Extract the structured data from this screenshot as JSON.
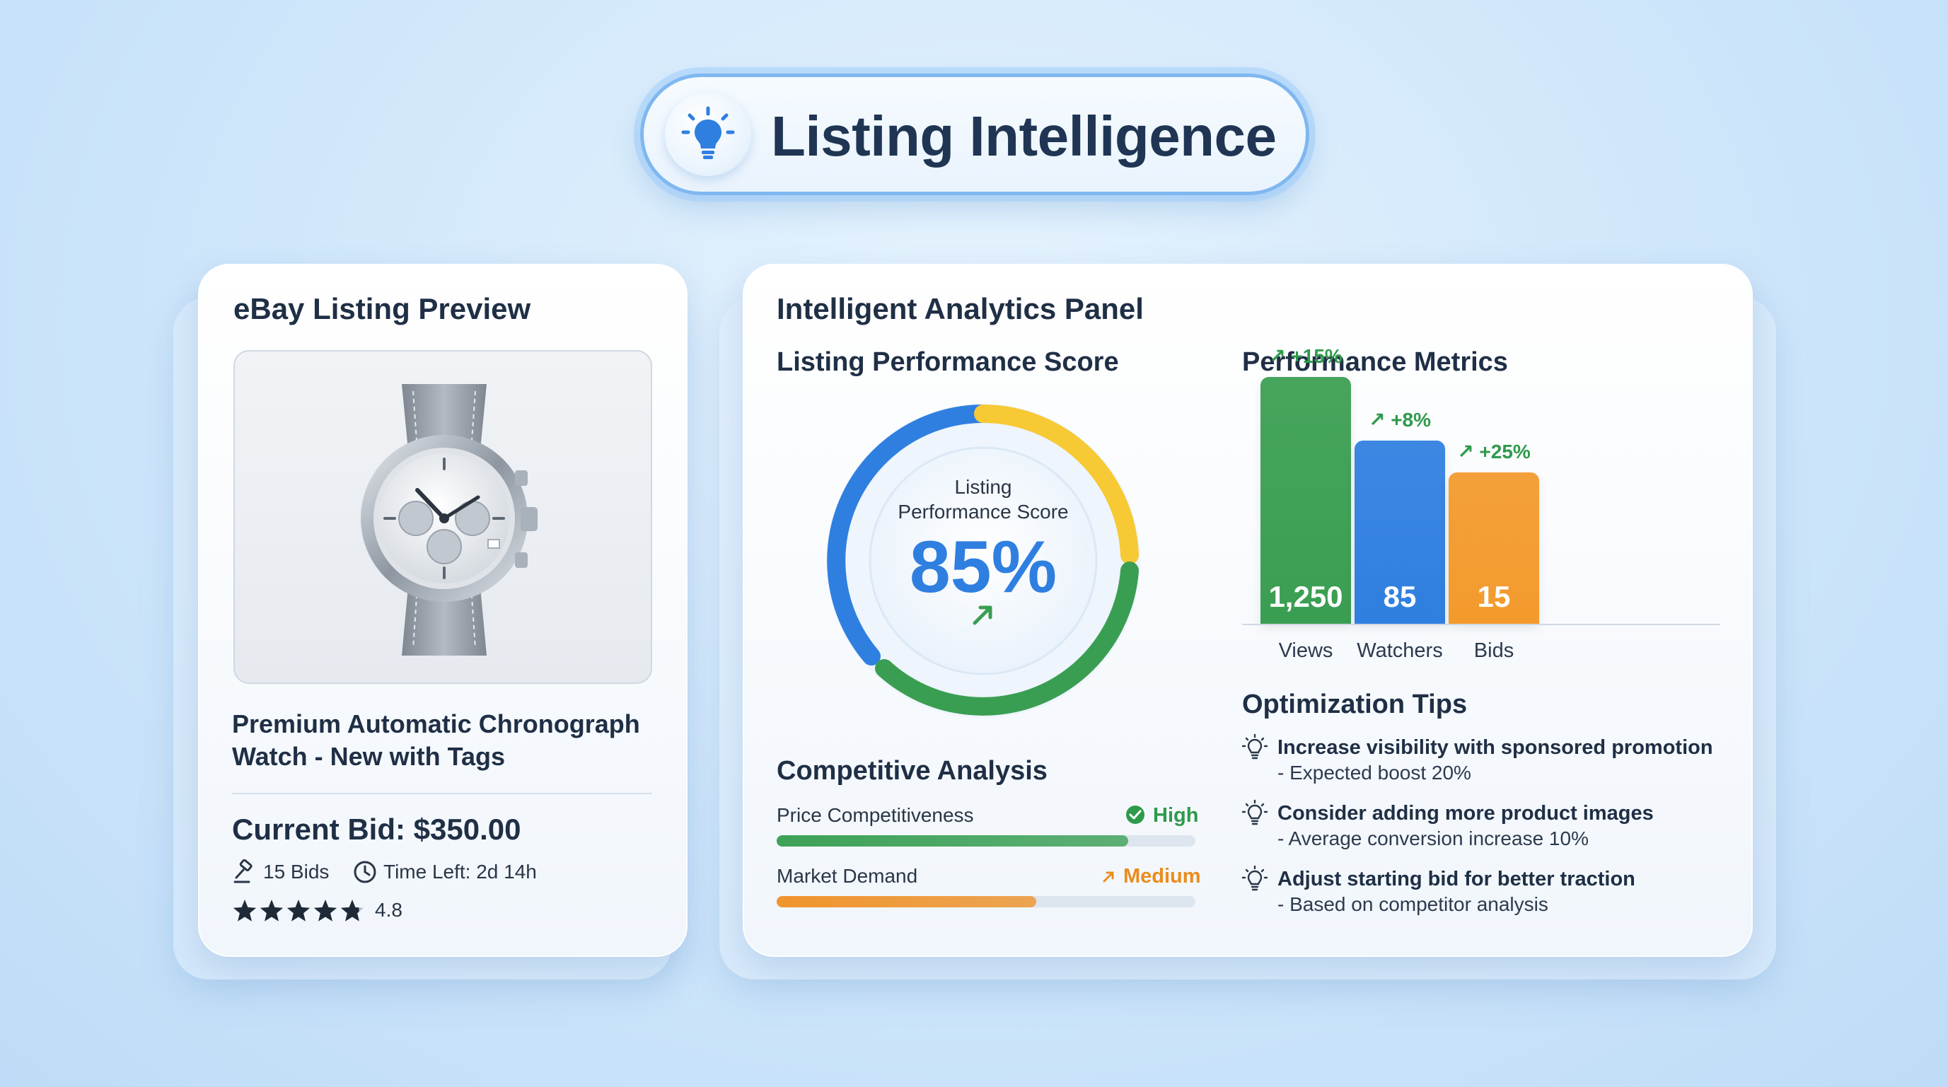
{
  "header": {
    "title": "Listing Intelligence",
    "icon": "lightbulb-icon"
  },
  "listing": {
    "heading": "eBay Listing Preview",
    "product_title_line1": "Premium Automatic Chronograph",
    "product_title_line2": "Watch - New with Tags",
    "current_bid": "Current Bid: $350.00",
    "bids": "15 Bids",
    "time_left": "Time Left: 2d 14h",
    "rating": 4.8,
    "rating_text": "4.8",
    "stars_total": 5
  },
  "analytics": {
    "heading": "Intelligent Analytics Panel",
    "score": {
      "heading": "Listing Performance Score",
      "label_line1": "Listing",
      "label_line2": "Performance Score",
      "value_text": "85%"
    },
    "competitive": {
      "heading": "Competitive Analysis",
      "rows": [
        {
          "label": "Price Competitiveness",
          "status": "High",
          "level_pct": 84,
          "color": "#3da257",
          "status_color": "#2e9a4c"
        },
        {
          "label": "Market Demand",
          "status": "Medium",
          "level_pct": 62,
          "color": "#f0942c",
          "status_color": "#ea8d1d"
        }
      ]
    },
    "metrics": {
      "heading": "Performance Metrics",
      "items": [
        {
          "label": "Views",
          "value": "1,250",
          "change": "+15%",
          "color": "#3a9e52"
        },
        {
          "label": "Watchers",
          "value": "85",
          "change": "+8%",
          "color": "#2f7fe0"
        },
        {
          "label": "Bids",
          "value": "15",
          "change": "+25%",
          "color": "#f39a2c"
        }
      ]
    },
    "tips": {
      "heading": "Optimization Tips",
      "items": [
        {
          "title": "Increase visibility with sponsored promotion",
          "detail": "- Expected boost 20%"
        },
        {
          "title": "Consider adding more product images",
          "detail": "- Average conversion increase 10%"
        },
        {
          "title": "Adjust starting bid for better traction",
          "detail": "- Based on competitor analysis"
        }
      ]
    }
  },
  "chart_data": {
    "type": "bar",
    "categories": [
      "Views",
      "Watchers",
      "Bids"
    ],
    "values": [
      1250,
      85,
      15
    ],
    "title": "Performance Metrics",
    "xlabel": "",
    "ylabel": "",
    "annotations": [
      "+15%",
      "+8%",
      "+25%"
    ]
  },
  "colors": {
    "accent_blue": "#2f7fe0",
    "green": "#3a9e52",
    "orange": "#f39a2c",
    "yellow": "#f7c934"
  }
}
